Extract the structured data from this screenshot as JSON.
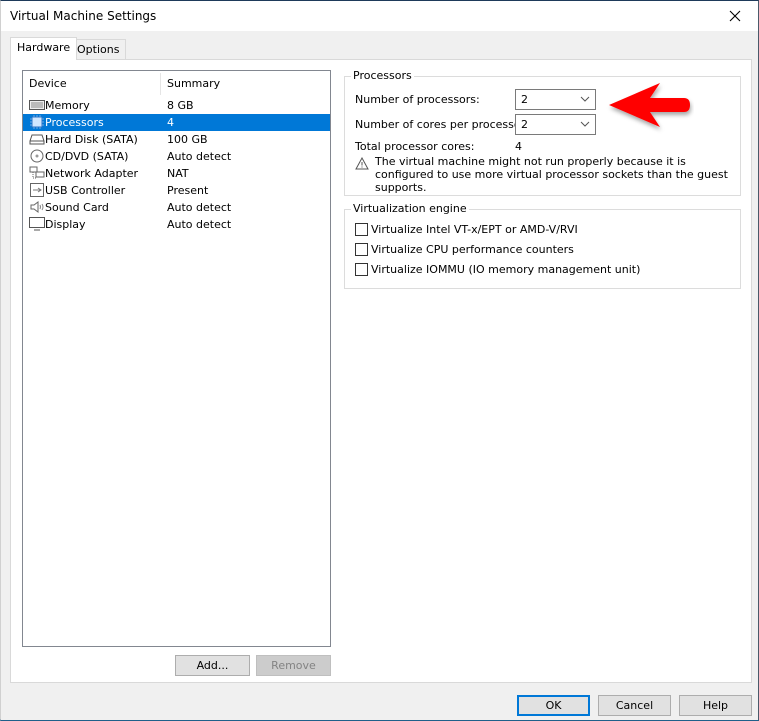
{
  "window": {
    "title": "Virtual Machine Settings",
    "close_icon": "close-icon"
  },
  "tabs": [
    {
      "label": "Hardware",
      "active": true
    },
    {
      "label": "Options",
      "active": false
    }
  ],
  "device_list": {
    "columns": [
      "Device",
      "Summary"
    ],
    "rows": [
      {
        "device": "Memory",
        "summary": "8 GB",
        "icon": "memory-icon",
        "selected": false
      },
      {
        "device": "Processors",
        "summary": "4",
        "icon": "processor-icon",
        "selected": true
      },
      {
        "device": "Hard Disk (SATA)",
        "summary": "100 GB",
        "icon": "hard-disk-icon",
        "selected": false
      },
      {
        "device": "CD/DVD (SATA)",
        "summary": "Auto detect",
        "icon": "cd-dvd-icon",
        "selected": false
      },
      {
        "device": "Network Adapter",
        "summary": "NAT",
        "icon": "network-adapter-icon",
        "selected": false
      },
      {
        "device": "USB Controller",
        "summary": "Present",
        "icon": "usb-icon",
        "selected": false
      },
      {
        "device": "Sound Card",
        "summary": "Auto detect",
        "icon": "speaker-icon",
        "selected": false
      },
      {
        "device": "Display",
        "summary": "Auto detect",
        "icon": "monitor-icon",
        "selected": false
      }
    ],
    "add_label": "Add...",
    "remove_label": "Remove"
  },
  "processors": {
    "group_title": "Processors",
    "num_processors_label": "Number of processors:",
    "num_processors_value": "2",
    "cores_per_processor_label": "Number of cores per processor:",
    "cores_per_processor_value": "2",
    "total_cores_label": "Total processor cores:",
    "total_cores_value": "4",
    "warning": "The virtual machine might not run properly because it is configured to use more virtual processor sockets than the guest supports."
  },
  "virtualization": {
    "group_title": "Virtualization engine",
    "options": [
      {
        "label": "Virtualize Intel VT-x/EPT or AMD-V/RVI",
        "checked": false
      },
      {
        "label": "Virtualize CPU performance counters",
        "checked": false
      },
      {
        "label": "Virtualize IOMMU (IO memory management unit)",
        "checked": false
      }
    ]
  },
  "footer": {
    "ok_label": "OK",
    "cancel_label": "Cancel",
    "help_label": "Help"
  },
  "annotation": {
    "arrow_color": "#ff0000",
    "selection_color": "#0078d7"
  }
}
